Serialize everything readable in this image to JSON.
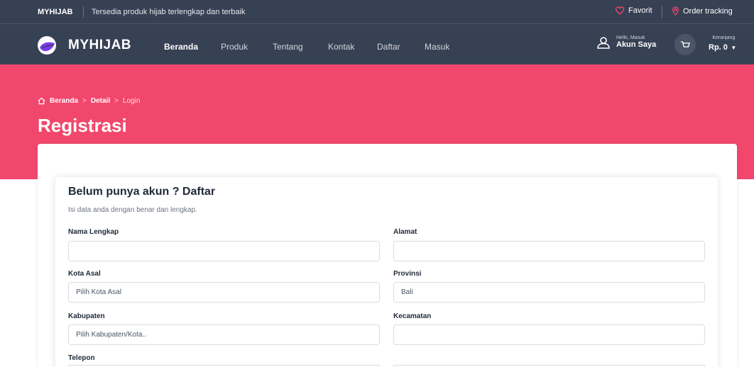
{
  "topbar": {
    "brand": "MYHIJAB",
    "tagline": "Tersedia produk hijab terlengkap dan terbaik",
    "favorite_label": "Favorit",
    "order_tracking_label": "Order tracking"
  },
  "navbar": {
    "brand": "MYHIJAB",
    "items": [
      {
        "label": "Beranda",
        "active": true
      },
      {
        "label": "Produk",
        "active": false
      },
      {
        "label": "Tentang",
        "active": false
      },
      {
        "label": "Kontak",
        "active": false
      },
      {
        "label": "Daftar",
        "active": false
      },
      {
        "label": "Masuk",
        "active": false
      }
    ],
    "account_greeting": "Hello, Masuk",
    "account_label": "Akun Saya",
    "cart_caption": "Keranjang",
    "cart_total": "Rp. 0"
  },
  "hero": {
    "breadcrumb": [
      "Beranda",
      "Detail",
      "Login"
    ],
    "title": "Registrasi"
  },
  "form": {
    "title": "Belum punya akun ? Daftar",
    "subtitle": "Isi data anda dengan benar dan lengkap.",
    "fields": {
      "nama_lengkap": {
        "label": "Nama Lengkap",
        "value": ""
      },
      "alamat": {
        "label": "Alamat",
        "value": ""
      },
      "kota_asal": {
        "label": "Kota Asal",
        "value": "Pilih Kota Asal"
      },
      "provinsi": {
        "label": "Provinsi",
        "value": "Bali"
      },
      "kabupaten": {
        "label": "Kabupaten",
        "value": "Pilih Kabupaten/Kota.."
      },
      "kecamatan": {
        "label": "Kecamatan",
        "value": ""
      },
      "telepon": {
        "label": "Telepon",
        "value": ""
      }
    }
  },
  "colors": {
    "header_bg": "#374154",
    "hero_bg": "#f2476d",
    "logo_accent": "#7c3aed"
  }
}
